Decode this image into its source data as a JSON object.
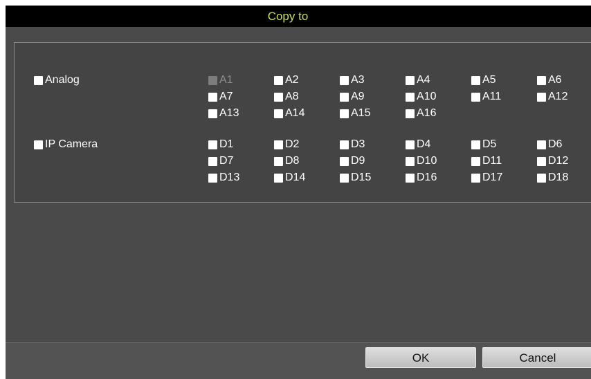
{
  "dialog": {
    "title": "Copy to",
    "groups": [
      {
        "label": "Analog",
        "channels": [
          "A1",
          "A2",
          "A3",
          "A4",
          "A5",
          "A6",
          "A7",
          "A8",
          "A9",
          "A10",
          "A11",
          "A12",
          "A13",
          "A14",
          "A15",
          "A16"
        ],
        "disabled": [
          "A1"
        ]
      },
      {
        "label": "IP Camera",
        "channels": [
          "D1",
          "D2",
          "D3",
          "D4",
          "D5",
          "D6",
          "D7",
          "D8",
          "D9",
          "D10",
          "D11",
          "D12",
          "D13",
          "D14",
          "D15",
          "D16",
          "D17",
          "D18"
        ],
        "disabled": []
      }
    ],
    "ok_label": "OK",
    "cancel_label": "Cancel"
  },
  "colors": {
    "title_text": "#c8de6a",
    "background": "#4a4a4a",
    "titlebar": "#000000"
  }
}
